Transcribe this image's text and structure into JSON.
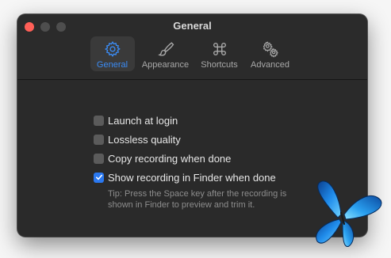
{
  "window": {
    "title": "General"
  },
  "tabs": [
    {
      "label": "General",
      "icon": "gear-icon",
      "active": true
    },
    {
      "label": "Appearance",
      "icon": "paintbrush-icon",
      "active": false
    },
    {
      "label": "Shortcuts",
      "icon": "command-icon",
      "active": false
    },
    {
      "label": "Advanced",
      "icon": "gears-icon",
      "active": false
    }
  ],
  "options": [
    {
      "label": "Launch at login",
      "checked": false
    },
    {
      "label": "Lossless quality",
      "checked": false
    },
    {
      "label": "Copy recording when done",
      "checked": false
    },
    {
      "label": "Show recording in Finder when done",
      "checked": true
    }
  ],
  "tip": "Tip: Press the Space key after the recording is shown in Finder to preview and trim it.",
  "colors": {
    "accent": "#3b8cf5",
    "checkbox_checked": "#2a78f0",
    "window_bg": "#2a2a2a",
    "close_button": "#ff5f57"
  }
}
